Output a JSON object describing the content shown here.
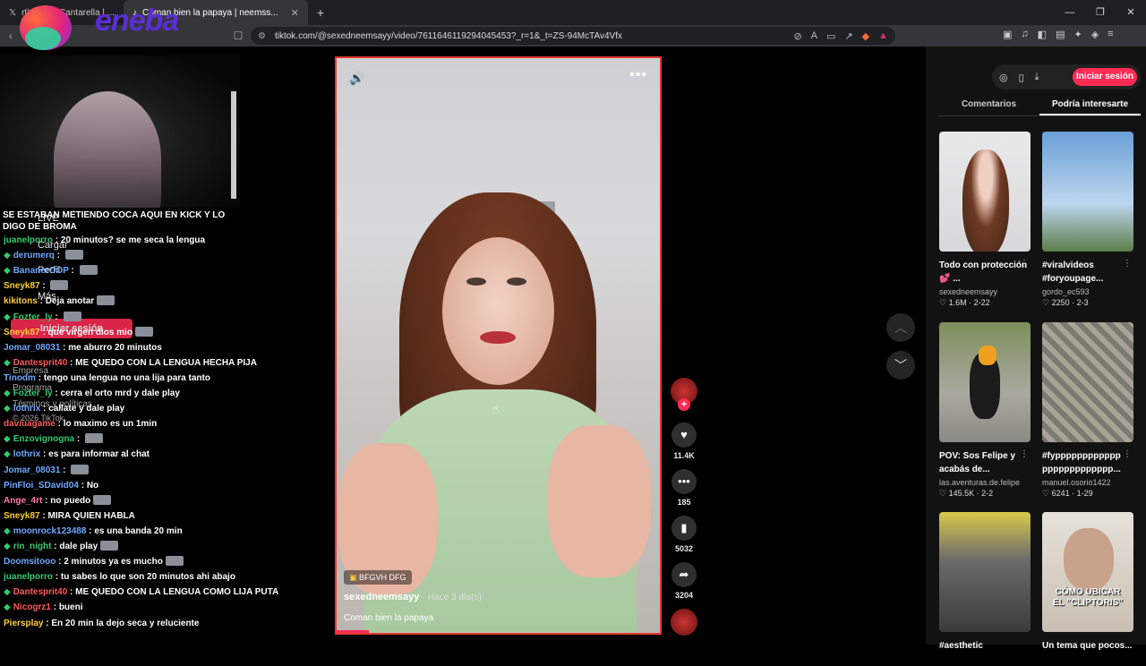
{
  "browser": {
    "tabs": [
      {
        "label": "rt) on X: \"Cantarella | ...",
        "icon": "x-logo-icon"
      },
      {
        "label": "Coman bien la papaya | neemss...",
        "icon": "tiktok-logo-icon",
        "active": true
      }
    ],
    "new_tab": "+",
    "url": "tiktok.com/@sexedneemsayy/video/7611646119294045453?_r=1&_t=ZS-94McTAv4Vfx"
  },
  "overlay_logo": "eneba",
  "stream_chat": {
    "top_message": "SE ESTABAN METIENDO COCA AQUI EN KICK Y  LO DIGO DE BROMA",
    "messages": [
      {
        "user": "juanelporro",
        "color": "#2ecc71",
        "text": "20 minutos? se me seca la lengua",
        "badge": false,
        "emote": false
      },
      {
        "user": "derumerq",
        "color": "#6fa8ff",
        "text": "",
        "badge": true,
        "emote": true
      },
      {
        "user": "BananerOOP",
        "color": "#6fa8ff",
        "text": "",
        "badge": true,
        "emote": true
      },
      {
        "user": "Sneyk87",
        "color": "#ffcc33",
        "text": "",
        "badge": false,
        "emote": true
      },
      {
        "user": "kikitons",
        "color": "#ffcc33",
        "text": "Deja anotar",
        "badge": false,
        "emote": true
      },
      {
        "user": "Fozter_ly",
        "color": "#2ecc71",
        "text": "",
        "badge": true,
        "emote": true
      },
      {
        "user": "Sneyk87",
        "color": "#ffcc33",
        "text": "que virgen dios mio",
        "badge": false,
        "emote": true
      },
      {
        "user": "Jomar_08031",
        "color": "#6fa8ff",
        "text": "me aburro 20 minutos",
        "badge": false,
        "emote": false
      },
      {
        "user": "Dantesprit40",
        "color": "#ff5a5a",
        "text": "ME QUEDO CON LA LENGUA HECHA PIJA",
        "badge": true,
        "emote": false
      },
      {
        "user": "Tinodm",
        "color": "#6fa8ff",
        "text": "tengo una lengua no una lija para tanto",
        "badge": false,
        "emote": false
      },
      {
        "user": "Fozter_ly",
        "color": "#2ecc71",
        "text": "cerra el orto mrd y dale play",
        "badge": true,
        "emote": false
      },
      {
        "user": "lothrix",
        "color": "#6fa8ff",
        "text": "callate y dale play",
        "badge": true,
        "emote": false
      },
      {
        "user": "daviuagame",
        "color": "#ff5a5a",
        "text": "lo maximo es un 1min",
        "badge": false,
        "emote": false
      },
      {
        "user": "Enzovignogna",
        "color": "#2ecc71",
        "text": "",
        "badge": true,
        "emote": true
      },
      {
        "user": "lothrix",
        "color": "#6fa8ff",
        "text": "es para informar al chat",
        "badge": true,
        "emote": false
      },
      {
        "user": "Jomar_08031",
        "color": "#6fa8ff",
        "text": "",
        "badge": false,
        "emote": true
      },
      {
        "user": "PinFloi_SDavid04",
        "color": "#6fa8ff",
        "text": "No",
        "badge": false,
        "emote": false
      },
      {
        "user": "Ange_4rt",
        "color": "#ff7aa8",
        "text": "no puedo",
        "badge": false,
        "emote": true
      },
      {
        "user": "Sneyk87",
        "color": "#ffcc33",
        "text": "MIRA QUIEN HABLA",
        "badge": false,
        "emote": false
      },
      {
        "user": "moonrock123488",
        "color": "#6fa8ff",
        "text": "es una banda 20 min",
        "badge": true,
        "emote": false
      },
      {
        "user": "rin_night",
        "color": "#2ecc71",
        "text": "dale play",
        "badge": true,
        "emote": true
      },
      {
        "user": "Doomsitooo",
        "color": "#6fa8ff",
        "text": "2 minutos ya es mucho",
        "badge": false,
        "emote": true
      },
      {
        "user": "juanelporro",
        "color": "#2ecc71",
        "text": "tu sabes lo que son 20 minutos ahi abajo",
        "badge": false,
        "emote": false
      },
      {
        "user": "Dantesprit40",
        "color": "#ff5a5a",
        "text": "ME QUEDO CON LA LENGUA COMO LIJA PUTA",
        "badge": true,
        "emote": false
      },
      {
        "user": "Nicogrz1",
        "color": "#ff5a5a",
        "text": "bueni",
        "badge": true,
        "emote": false
      },
      {
        "user": "Piersplay",
        "color": "#ffcc33",
        "text": "En 20 min la dejo seca y reluciente",
        "badge": false,
        "emote": false
      }
    ]
  },
  "tiktok_menu": {
    "live": "LIVE",
    "cargar": "Cargar",
    "perfil": "Perfil",
    "mas": "Más",
    "login": "Iniciar sesión",
    "empresa": "Empresa",
    "programa": "Programa",
    "terminos": "Términos y políticas",
    "copyright": "© 2026 TikTok"
  },
  "video": {
    "tag": "BFGVH DFG",
    "author": "sexedneemsayy",
    "time": "Hace 3 día(s)",
    "separator": "·",
    "caption": "Coman bien la papaya",
    "progress": 0.1,
    "likes": "11.4K",
    "comments": "185",
    "saves": "5032",
    "shares": "3204"
  },
  "panel": {
    "login": "Iniciar sesión",
    "tabs": [
      "Comentarios",
      "Podría interesarte"
    ],
    "cards": [
      {
        "title": "Todo con protección 💕 ...",
        "user": "sexedneemsayy",
        "stats": "1.6M · 2-22",
        "thumb_text": ""
      },
      {
        "title": "#viralvideos #foryoupage...",
        "user": "gordo_ec593",
        "stats": "2250 · 2-3",
        "thumb_text": ""
      },
      {
        "title": "POV: Sos Felipe y acabás de...",
        "user": "las.aventuras.de.felipe",
        "stats": "145.5K · 2-2",
        "thumb_text": ""
      },
      {
        "title": "#fypppppppppppp ppppppppppppp...",
        "user": "manuel.osorio1422",
        "stats": "6241 · 1-29",
        "thumb_text": ""
      },
      {
        "title": "#aesthetic",
        "user": "",
        "stats": "",
        "thumb_text": ""
      },
      {
        "title": "Un tema que pocos...",
        "user": "",
        "stats": "",
        "thumb_text": "CÓMO UBICAR EL \"CLIPTORIS\""
      }
    ]
  },
  "colors": {
    "brand": "#fe2c55",
    "video_border": "#e53935"
  }
}
